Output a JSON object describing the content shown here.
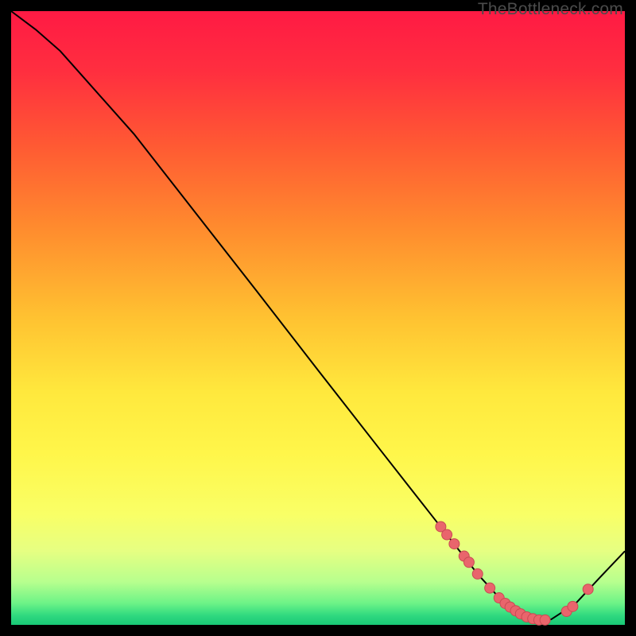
{
  "watermark": "TheBottleneck.com",
  "colors": {
    "frame": "#000000",
    "curve": "#000000",
    "marker_fill": "#e9656c",
    "marker_stroke": "#c94b53",
    "gradient_stops": [
      {
        "offset": 0.0,
        "color": "#ff1a44"
      },
      {
        "offset": 0.1,
        "color": "#ff2f3f"
      },
      {
        "offset": 0.22,
        "color": "#ff5a33"
      },
      {
        "offset": 0.35,
        "color": "#ff8a2e"
      },
      {
        "offset": 0.5,
        "color": "#ffc231"
      },
      {
        "offset": 0.62,
        "color": "#ffe83d"
      },
      {
        "offset": 0.72,
        "color": "#fff64a"
      },
      {
        "offset": 0.82,
        "color": "#f9ff66"
      },
      {
        "offset": 0.88,
        "color": "#e6ff82"
      },
      {
        "offset": 0.93,
        "color": "#b7ff8e"
      },
      {
        "offset": 0.965,
        "color": "#6cf387"
      },
      {
        "offset": 0.985,
        "color": "#2fd97f"
      },
      {
        "offset": 1.0,
        "color": "#18c877"
      }
    ]
  },
  "chart_data": {
    "type": "line",
    "title": "",
    "xlabel": "",
    "ylabel": "",
    "xlim": [
      0,
      100
    ],
    "ylim": [
      0,
      100
    ],
    "series": [
      {
        "name": "bottleneck-curve",
        "x": [
          0,
          4,
          8,
          12,
          20,
          30,
          40,
          50,
          60,
          68,
          72,
          76,
          80,
          82,
          84,
          86,
          88,
          92,
          96,
          100
        ],
        "y": [
          100,
          97,
          93.5,
          89,
          80,
          67.2,
          54.4,
          41.5,
          28.7,
          18.5,
          13.4,
          8.3,
          3.9,
          2.3,
          1.3,
          0.8,
          0.9,
          3.5,
          7.8,
          12.0
        ]
      }
    ],
    "markers": {
      "name": "highlight-points",
      "x": [
        70.0,
        71.0,
        72.2,
        73.8,
        74.6,
        76.0,
        78.0,
        79.5,
        80.5,
        81.3,
        82.2,
        83.0,
        84.0,
        85.0,
        86.0,
        87.0,
        90.5,
        91.5,
        94.0
      ],
      "y": [
        16.0,
        14.7,
        13.2,
        11.2,
        10.2,
        8.3,
        6.0,
        4.4,
        3.5,
        2.9,
        2.3,
        1.8,
        1.3,
        1.0,
        0.8,
        0.8,
        2.2,
        3.0,
        5.8
      ]
    }
  }
}
